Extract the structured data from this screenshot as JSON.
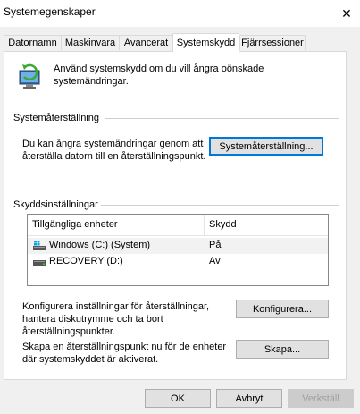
{
  "window": {
    "title": "Systemegenskaper",
    "close_glyph": "✕"
  },
  "tabs": [
    {
      "label": "Datornamn",
      "active": false
    },
    {
      "label": "Maskinvara",
      "active": false
    },
    {
      "label": "Avancerat",
      "active": false
    },
    {
      "label": "Systemskydd",
      "active": true
    },
    {
      "label": "Fjärrsessioner",
      "active": false
    }
  ],
  "intro": {
    "text": "Använd systemskydd om du vill ångra oönskade systemändringar.",
    "icon": "system-protection-shield-icon"
  },
  "restore": {
    "group_title": "Systemåterställning",
    "description": "Du kan ångra systemändringar genom att återställa datorn till en återställningspunkt.",
    "button_label": "Systemåterställning..."
  },
  "protection": {
    "group_title": "Skyddsinställningar",
    "columns": [
      "Tillgängliga enheter",
      "Skydd"
    ],
    "drives": [
      {
        "name": "Windows (C:) (System)",
        "status": "På",
        "icon": "windows-drive-icon",
        "selected": true
      },
      {
        "name": "RECOVERY (D:)",
        "status": "Av",
        "icon": "hard-drive-icon",
        "selected": false
      }
    ],
    "configure_text": "Konfigurera inställningar för återställningar, hantera diskutrymme och ta bort återställningspunkter.",
    "configure_button": "Konfigurera...",
    "create_text": "Skapa en återställningspunkt nu för de enheter där systemskyddet är aktiverat.",
    "create_button": "Skapa..."
  },
  "footer": {
    "ok": "OK",
    "cancel": "Avbryt",
    "apply": "Verkställ"
  }
}
